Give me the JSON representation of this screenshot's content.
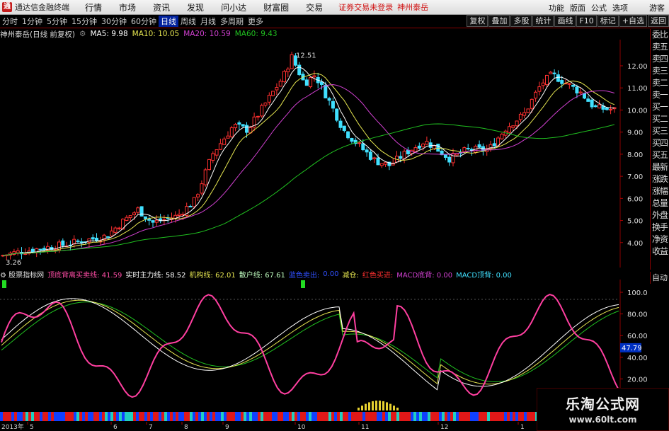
{
  "topbar": {
    "app_name": "通达信金融终端",
    "menus": [
      "行情",
      "市场",
      "资讯",
      "发现",
      "问小达",
      "财富圈",
      "交易"
    ],
    "broker_text": "证券交易未登录",
    "broker_name": "神州泰岳",
    "right_menus": [
      "功能",
      "版面",
      "公式",
      "选项",
      "游客"
    ]
  },
  "periodbar": {
    "periods": [
      "分时",
      "1分钟",
      "5分钟",
      "15分钟",
      "30分钟",
      "60分钟",
      "日线",
      "周线",
      "月线",
      "多周期",
      "更多"
    ],
    "active": "日线",
    "tools": [
      "复权",
      "叠加",
      "多股",
      "统计",
      "画线",
      "F10",
      "标记",
      "+自选",
      "返回"
    ]
  },
  "main_info": {
    "stock": "神州泰岳(日线 前复权)",
    "ma5": "MA5: 9.98",
    "ma10": "MA10: 10.05",
    "ma20": "MA20: 10.59",
    "ma60": "MA60: 9.43",
    "high_label": "12.51",
    "low_label": "3.26",
    "price_ticks": [
      "12.00",
      "11.00",
      "10.00",
      "9.00",
      "8.00",
      "7.00",
      "6.00",
      "5.00",
      "4.00"
    ],
    "colors": {
      "ma5": "#ffffff",
      "ma10": "#e6e650",
      "ma20": "#d040d0",
      "ma60": "#20c020",
      "up": "#ff3030",
      "down": "#40e0ff"
    }
  },
  "side_panel": [
    "委比",
    "卖五",
    "卖四",
    "卖三",
    "卖二",
    "卖一",
    "买一",
    "买二",
    "买三",
    "买四",
    "买五",
    "最新",
    "涨跌",
    "涨幅",
    "总量",
    "外盘",
    "换手",
    "净资",
    "收益"
  ],
  "auto_label": "自动",
  "sub_info": {
    "name": "股票指标网",
    "items": [
      {
        "text": "顶底背离买卖线: 41.59",
        "color": "#ff4da6"
      },
      {
        "text": "实时主力线: 58.52",
        "color": "#ffffff"
      },
      {
        "text": "机构线: 62.01",
        "color": "#e6e650"
      },
      {
        "text": "散户线: 67.61",
        "color": "#c0ffc0"
      },
      {
        "text": "蓝色卖出:",
        "color": "#3050ff"
      },
      {
        "text": "0.00",
        "color": "#3050ff"
      },
      {
        "text": "减仓:",
        "color": "#e6e650"
      },
      {
        "text": "红色买进:",
        "color": "#ff3030"
      },
      {
        "text": "MACD底背: 0.00",
        "color": "#d040d0"
      },
      {
        "text": "MACD顶背: 0.00",
        "color": "#40e0ff"
      }
    ],
    "ticks": [
      "100.0",
      "80.00",
      "60.00",
      "40.00",
      "20.00"
    ],
    "current_value": "47.79"
  },
  "date_axis": {
    "year_label": "2013年",
    "months": [
      "5",
      "6",
      "7",
      "8",
      "9",
      "10",
      "11",
      "12",
      "1"
    ]
  },
  "watermark": {
    "line1": "乐淘公式网",
    "line2": "www.60lt.com"
  }
}
